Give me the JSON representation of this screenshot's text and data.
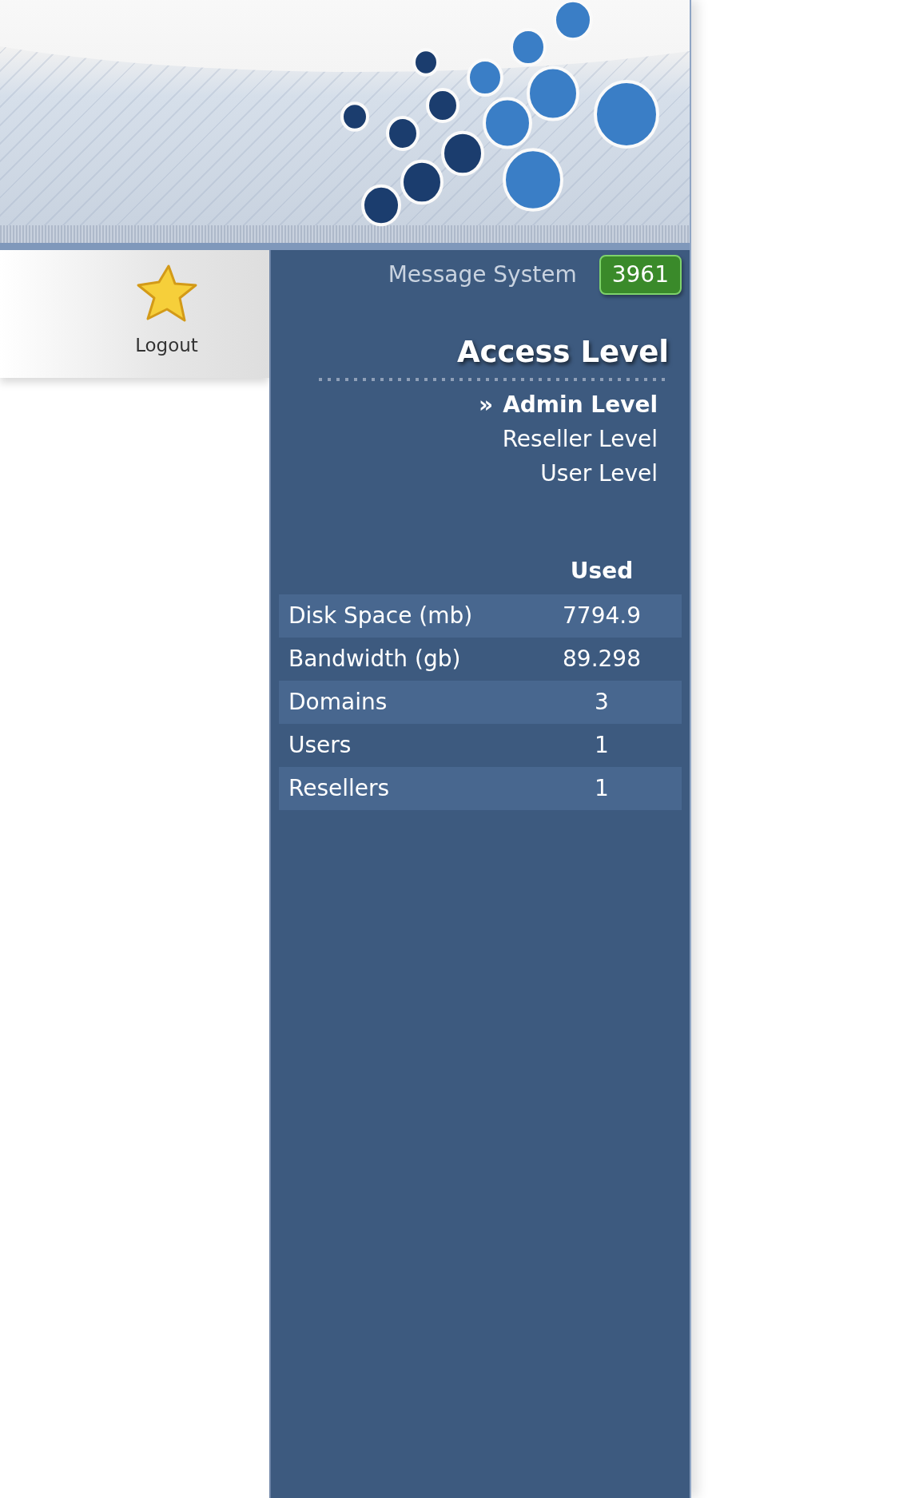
{
  "toolbar": {
    "items": [
      {
        "label": "Logout"
      }
    ]
  },
  "message_system": {
    "label": "Message System",
    "count": "3961"
  },
  "access_level": {
    "title": "Access Level",
    "marker": "»",
    "levels": [
      {
        "label": "Admin Level",
        "selected": true
      },
      {
        "label": "Reseller Level",
        "selected": false
      },
      {
        "label": "User Level",
        "selected": false
      }
    ]
  },
  "usage": {
    "column": "Used",
    "rows": [
      {
        "name": "Disk Space (mb)",
        "used": "7794.9"
      },
      {
        "name": "Bandwidth (gb)",
        "used": "89.298"
      },
      {
        "name": "Domains",
        "used": "3"
      },
      {
        "name": "Users",
        "used": "1"
      },
      {
        "name": "Resellers",
        "used": "1"
      }
    ]
  }
}
